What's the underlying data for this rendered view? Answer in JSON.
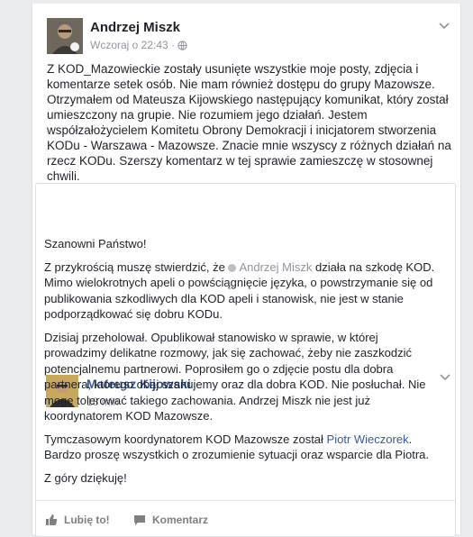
{
  "post": {
    "author": "Andrzej Miszk",
    "timestamp": "Wczoraj o 22:43",
    "separator": "·",
    "privacy_icon": "globe-icon",
    "text": "Z KOD_Mazowieckie zostały usunięte wszystkie moje posty, zdjęcia i komentarze setek osób. Nie mam również dostępu do grupy Mazowsze. Otrzymałem od Mateusza Kijowskiego następujący komunikat, który został umieszczony na grupie. Nie rozumiem jego działań. Jestem współzałożycielem Komitetu Obrony Demokracji i inicjatorem stworzenia KODu - Warszawa - Mazowsze. Znacie mnie wszyscy z różnych działań na rzecz KODu.  Szerszy komentarz w tej sprawie zamieszczę w stosownej chwili."
  },
  "shared": {
    "author": "Mateusz Kijowski",
    "timestamp": "18 min",
    "greeting": "Szanowni Państwo!",
    "p1_before": "Z przykrością muszę stwierdzić, że ",
    "p1_mention": "Andrzej Miszk",
    "p1_after": " działa na szkodę KOD. Mimo wielokrotnych apeli o powściągnięcie języka, o powstrzymanie się od publikowania szkodliwych dla KOD apeli i stanowisk, nie jest w stanie podporządkować się dobru KODu.",
    "p2": "Dzisiaj przeholował. Opublikował stanowisko w sprawie, w której prowadzimy delikatne rozmowy, jak się zachować, żeby nie zaszkodzić potencjalnemu partnerowi. Poprosiłem go o zdjęcie postu dla dobra partnera, którego obaj szanujemy oraz dla dobra KOD. Nie posłuchał. Nie mogę tolerować takiego zachowania. Andrzej Miszk nie jest już koordynatorem KOD Mazowsze.",
    "p3_before": "Tymczasowym koordynatorem KOD Mazowsze został ",
    "p3_link": "Piotr Wieczorek",
    "p3_after": ". Bardzo proszę wszystkich o zrozumienie sytuacji oraz wsparcie dla Piotra.",
    "closing": "Z góry dziękuję!"
  },
  "actions": {
    "like_label": "Lubię to!",
    "comment_label": "Komentarz"
  },
  "colors": {
    "link": "#365899",
    "muted": "#90949c",
    "background": "#e9ebee"
  }
}
